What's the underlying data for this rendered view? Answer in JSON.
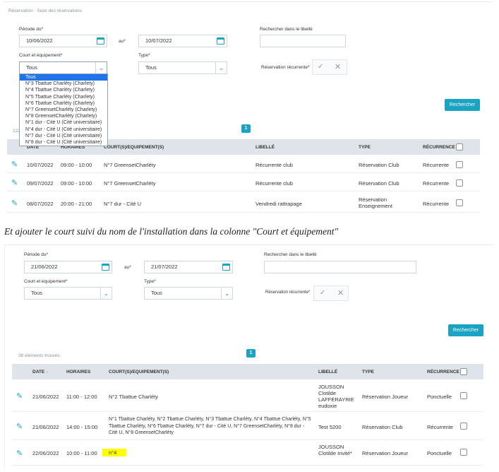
{
  "top": {
    "breadcrumb": "Réservation · Suivi des réservations",
    "period_label": "Période du*",
    "date_from": "10/06/2022",
    "au_label": "au*",
    "date_to": "10/07/2022",
    "search_label": "Rechercher dans le libellé",
    "court_label": "Court et équipement*",
    "court_value": "Tous",
    "type_label": "Type*",
    "type_value": "Tous",
    "recurrent_label": "Réservation récurrente*",
    "search_button": "Rechercher",
    "found_count": "122",
    "page_number": "1",
    "dropdown_options": [
      "Tous",
      "N°3 Tbattue Charléty (Charlety)",
      "N°4 Tbattue Charléty (Charlety)",
      "N°5 Tbattue Charléty (Charlety)",
      "N°6 Tbattue Charléty (Charlety)",
      "N°7 GreensetCharléty (Charlety)",
      "N°8 GreensetCharléty (Charlety)",
      "N°1 dur - Cité U (Cité universitaire)",
      "N°4 dur - Cité U (Cité universitaire)",
      "N°7 dur - Cité U (Cité universitaire)",
      "N°8 dur - Cité U (Cité universitaire)"
    ],
    "headers": {
      "date": "DATE",
      "horaires": "HORAIRES",
      "court": "COURT(S)/EQUIPEMENT(S)",
      "libelle": "LIBELLÉ",
      "type": "TYPE",
      "recurrence": "RÉCURRENCE"
    },
    "rows": [
      {
        "date": "10/07/2022",
        "time": "09:00 - 10:00",
        "court": "N°7 GreensetCharléty",
        "libelle": "Récurrente club",
        "type": "Réservation Club",
        "recurrence": "Récurrente"
      },
      {
        "date": "09/07/2022",
        "time": "09:00 - 10:00",
        "court": "N°7 GreensetCharléty",
        "libelle": "Récurrente club",
        "type": "Réservation Club",
        "recurrence": "Récurrente"
      },
      {
        "date": "08/07/2022",
        "time": "20:00 - 21:00",
        "court": "N°7 dur - Cité U",
        "libelle": "Vendredi rattrapage",
        "type": "Réservation Enseignement",
        "recurrence": "Récurrente"
      }
    ]
  },
  "caption": "Et ajouter le court suivi du nom de l'installation dans la colonne \"Court et équipement\"",
  "bottom": {
    "period_label": "Période du*",
    "date_from": "21/06/2022",
    "au_label": "au*",
    "date_to": "21/07/2022",
    "search_label": "Rechercher dans le libellé",
    "court_label": "Court et équipement*",
    "court_value": "Tous",
    "type_label": "Type*",
    "type_value": "Tous",
    "recurrent_label": "Réservation récurrente*",
    "search_button": "Rechercher",
    "found_text": "38 éléments trouvés.",
    "page_number": "1",
    "headers": {
      "date": "DATE",
      "sort_arrow": "↓",
      "horaires": "HORAIRES",
      "court": "COURT(S)/EQUIPEMENT(S)",
      "libelle": "LIBELLÉ",
      "type": "TYPE",
      "recurrence": "RÉCURRENCE"
    },
    "rows": [
      {
        "date": "21/06/2022",
        "time": "11:00 - 12:00",
        "court": "N°2 Tbattue Charléty",
        "libelle": "JOUSSON Clotilde LAFFERAYRIE eudoxie",
        "type": "Réservation Joueur",
        "recurrence": "Ponctuelle"
      },
      {
        "date": "21/06/2022",
        "time": "14:00 - 15:00",
        "court": "N°1 Tbattue Charléty, N°2 Tbattue Charléty, N°3 Tbattue Charléty, N°4 Tbattue Charléty, N°5 Tbattue Charléty, N°6 Tbattue Charléty, N°7 dur - Cité U, N°7 GreensetCharléty, N°8 dur - Cité U, N°8 GreensetCharléty",
        "libelle": "Test 5200",
        "type": "Réservation Club",
        "recurrence": "Récurrente"
      },
      {
        "date": "22/06/2022",
        "time": "10:00 - 11:00",
        "court": "n°4",
        "libelle": "JOUSSON Clotilde Invité*",
        "type": "Réservation Joueur",
        "recurrence": "Ponctuelle"
      }
    ]
  },
  "colors": {
    "accent": "#1aa3c2",
    "header_bg": "#dfe4ea",
    "highlight": "#ffff00",
    "selected": "#1e74e8"
  }
}
